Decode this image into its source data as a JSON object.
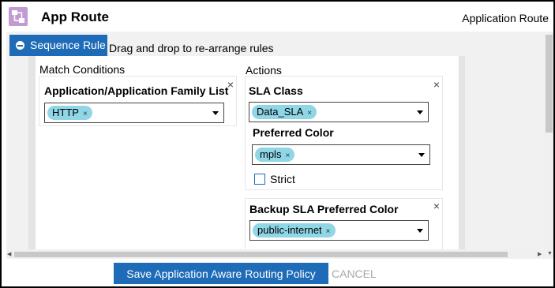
{
  "header": {
    "title": "App Route",
    "right_label": "Application Route",
    "icon": "app-route-icon"
  },
  "toolbar": {
    "sequence_button_label": "Sequence Rule",
    "hint": "Drag and drop to re-arrange rules"
  },
  "match_conditions": {
    "section_label": "Match Conditions",
    "app_list": {
      "label": "Application/Application Family List",
      "tags": [
        "HTTP"
      ]
    }
  },
  "actions": {
    "section_label": "Actions",
    "sla_class": {
      "label": "SLA Class",
      "tags": [
        "Data_SLA"
      ],
      "preferred_color_label": "Preferred Color",
      "preferred_color_tags": [
        "mpls"
      ],
      "strict_label": "Strict",
      "strict_checked": false
    },
    "backup_sla": {
      "label": "Backup SLA Preferred Color",
      "tags": [
        "public-internet"
      ]
    }
  },
  "footer": {
    "save_label": "Save Application Aware Routing Policy",
    "cancel_label": "CANCEL"
  },
  "glyphs": {
    "close": "×",
    "tag_remove": "×"
  },
  "colors": {
    "primary": "#1e6bb8",
    "tag_bg": "#8fd6e6",
    "icon_bg": "#c39bd3"
  }
}
